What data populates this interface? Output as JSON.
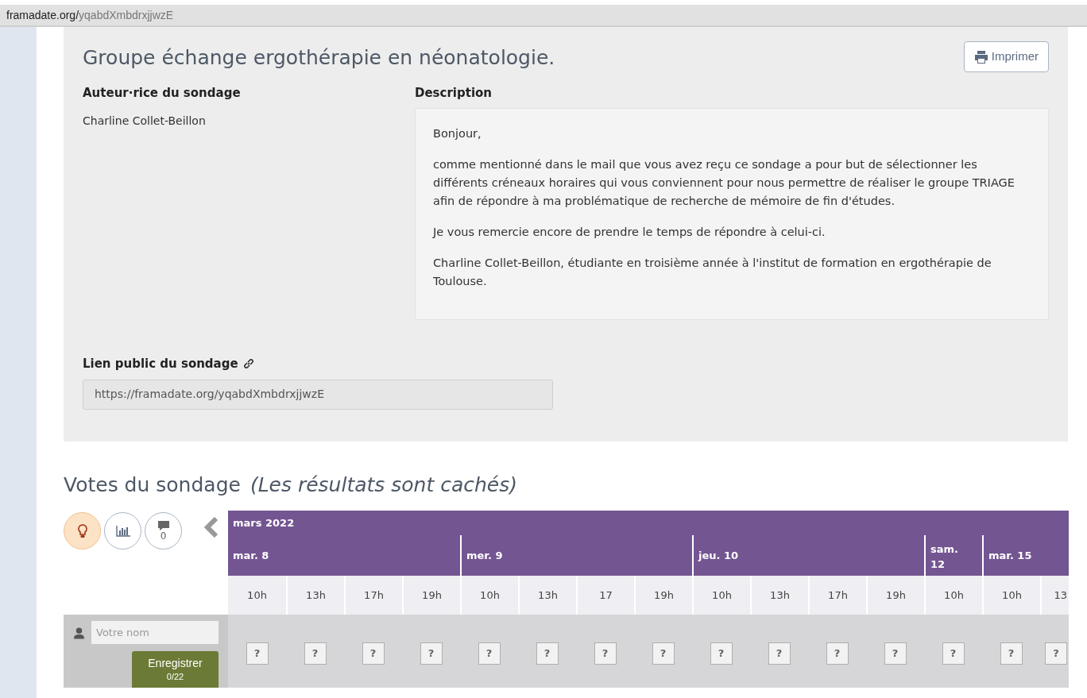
{
  "address_bar": {
    "domain": "framadate.org/",
    "path": "yqabdXmbdrxjjwzE"
  },
  "poll": {
    "title": "Groupe échange ergothérapie en néonatologie.",
    "print_button": "Imprimer",
    "author_label": "Auteur·rice du sondage",
    "author": "Charline Collet-Beillon",
    "description_label": "Description",
    "description": [
      "Bonjour,",
      "comme mentionné dans le mail que vous avez reçu ce sondage a pour but de sélectionner les différents créneaux horaires qui vous conviennent pour nous permettre de réaliser le groupe TRIAGE afin de répondre à ma problématique de recherche de mémoire de fin d'études.",
      "Je vous remercie encore de prendre le temps de répondre à celui-ci.",
      "Charline Collet-Beillon, étudiante en troisième année à l'institut de formation en ergothérapie de Toulouse."
    ],
    "public_link_label": "Lien public du sondage",
    "public_link": "https://framadate.org/yqabdXmbdrxjjwzE"
  },
  "votes": {
    "title": "Votes du sondage",
    "note": "(Les résultats sont cachés)",
    "comments_count": "0",
    "month": "mars 2022",
    "days": [
      {
        "label": "mar. 8",
        "hours": [
          {
            "label": "10h"
          },
          {
            "label": "13h"
          },
          {
            "label": "17h"
          },
          {
            "label": "19h"
          }
        ]
      },
      {
        "label": "mer. 9",
        "hours": [
          {
            "label": "10h"
          },
          {
            "label": "13h"
          },
          {
            "label": "17"
          },
          {
            "label": "19h"
          }
        ]
      },
      {
        "label": "jeu. 10",
        "hours": [
          {
            "label": "10h"
          },
          {
            "label": "13h"
          },
          {
            "label": "17h"
          },
          {
            "label": "19h"
          }
        ]
      },
      {
        "label": "sam. 12",
        "hours": [
          {
            "label": "10h"
          }
        ]
      },
      {
        "label": "mar. 15",
        "hours": [
          {
            "label": "10h"
          },
          {
            "label": "13"
          }
        ]
      }
    ],
    "vote_mark": "?",
    "name_placeholder": "Votre nom",
    "save_button": "Enregistrer",
    "save_count": "0/22"
  }
}
